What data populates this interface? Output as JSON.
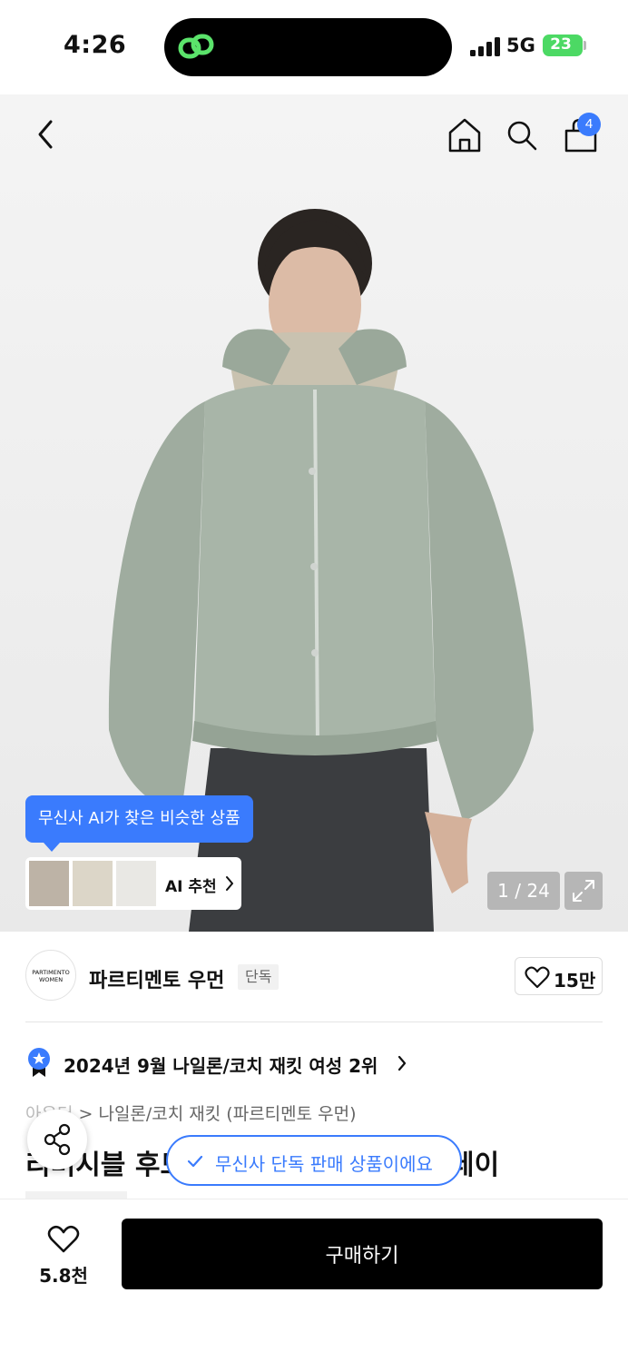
{
  "status_bar": {
    "time": "4:26",
    "network": "5G",
    "battery": "23"
  },
  "nav": {
    "cart_count": "4"
  },
  "image": {
    "ai_tooltip": "무신사 AI가 찾은 비슷한 상품",
    "ai_recommend_label": "AI 추천",
    "counter": "1 / 24"
  },
  "brand": {
    "logo_line1": "PARTIMENTO",
    "logo_line2": "WOMEN",
    "name": "파르티멘토 우먼",
    "badge": "단독",
    "likes": "15만"
  },
  "ranking": {
    "text": "2024년 9월 나일론/코치 재킷 여성 2위"
  },
  "breadcrumb": {
    "first": "아우터",
    "second": "나일론/코치 재킷 (파르티멘토 우먼)"
  },
  "product": {
    "title_left": "리버시블 후드",
    "title_right": "레이"
  },
  "exclusive_pill": "무신사 단독 판매 상품이에요",
  "bottom": {
    "wish_count": "5.8천",
    "buy_label": "구매하기"
  },
  "colors": {
    "accent": "#3a7bfd",
    "buy_button": "#000000",
    "jacket": "#a8b5a8"
  }
}
